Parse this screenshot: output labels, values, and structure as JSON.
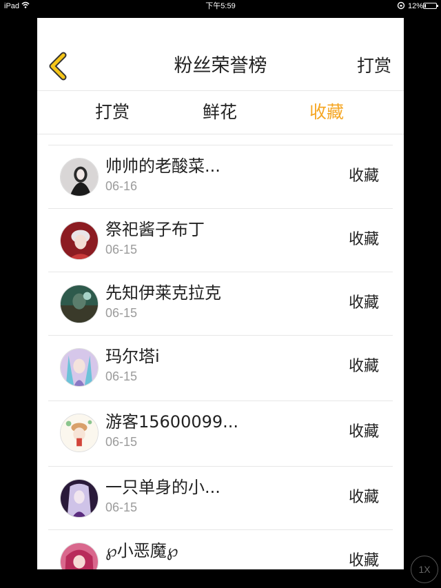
{
  "status_bar": {
    "device": "iPad",
    "time": "下午5:59",
    "battery": "12%",
    "battery_level": 0.12
  },
  "nav": {
    "title": "粉丝荣誉榜",
    "right_action": "打赏",
    "back_icon": "chevron-left-icon",
    "accent_color": "#f5a623"
  },
  "tabs": [
    {
      "label": "打赏",
      "active": false
    },
    {
      "label": "鲜花",
      "active": false
    },
    {
      "label": "收藏",
      "active": true
    }
  ],
  "fans": [
    {
      "name": "帅帅的老酸菜...",
      "date": "06-16",
      "action": "收藏"
    },
    {
      "name": "祭祀酱子布丁",
      "date": "06-15",
      "action": "收藏"
    },
    {
      "name": "先知伊莱克拉克",
      "date": "06-15",
      "action": "收藏"
    },
    {
      "name": "玛尔塔i",
      "date": "06-15",
      "action": "收藏"
    },
    {
      "name": "游客15600099...",
      "date": "06-15",
      "action": "收藏"
    },
    {
      "name": "一只单身的小...",
      "date": "06-15",
      "action": "收藏"
    },
    {
      "name": "℘小恶魔℘",
      "date": "",
      "action": "收藏"
    }
  ],
  "zoom_button": "1X"
}
